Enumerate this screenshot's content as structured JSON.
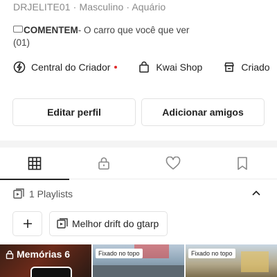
{
  "profile": {
    "meta": "DRJELITE01 · Masculino · Aquário",
    "bio_bold": "COMENTEM",
    "bio_rest": "- O carro que você que ver",
    "bio_line2": "(01)"
  },
  "links": [
    {
      "label": "Central do Criador",
      "icon": "lightning-icon",
      "has_dot": true
    },
    {
      "label": "Kwai Shop",
      "icon": "shopping-bag-icon"
    },
    {
      "label": "Criado",
      "icon": "store-icon"
    }
  ],
  "buttons": {
    "edit": "Editar perfil",
    "add_friends": "Adicionar amigos"
  },
  "tabs": [
    {
      "icon": "grid-icon",
      "active": true
    },
    {
      "icon": "lock-icon"
    },
    {
      "icon": "heart-icon"
    },
    {
      "icon": "bookmark-icon"
    }
  ],
  "playlists": {
    "header": "1 Playlists",
    "chip": "Melhor drift do gtarp"
  },
  "thumbnails": {
    "memories_label": "Memórias 6",
    "pinned_label": "Fixado no topo"
  },
  "colors": {
    "dot": "#e02c2c",
    "separator": "#f4f4f4"
  }
}
